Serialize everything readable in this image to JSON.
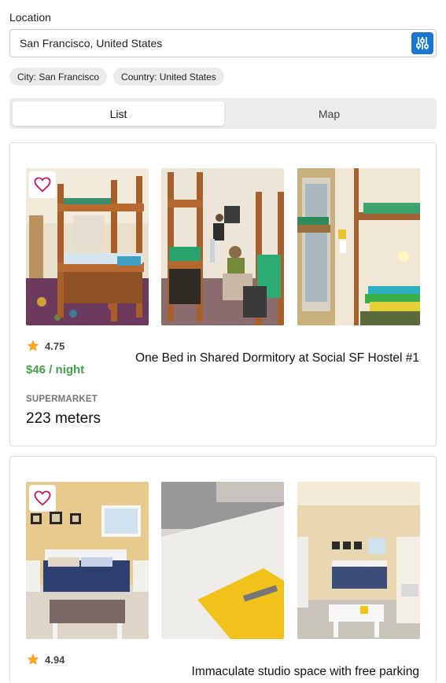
{
  "search": {
    "label": "Location",
    "value": "San Francisco, United States",
    "filter_icon": "sliders-icon"
  },
  "chips": [
    "City: San Francisco",
    "Country: United States"
  ],
  "tabs": {
    "list": "List",
    "map": "Map",
    "selected": "List"
  },
  "listings": [
    {
      "rating": "4.75",
      "price": "$46 / night",
      "title": "One Bed in Shared Dormitory at Social SF Hostel #1",
      "poi_label": "SUPERMARKET",
      "poi_value": "223 meters",
      "favorite_icon": "heart-outline-icon",
      "rating_icon": "star-icon"
    },
    {
      "rating": "4.94",
      "title": "Immaculate studio space with free parking",
      "favorite_icon": "heart-outline-icon",
      "rating_icon": "star-icon"
    }
  ],
  "colors": {
    "accent": "#1976d2",
    "price": "#43a047",
    "star": "#f5a623",
    "heart": "#c2185b"
  }
}
